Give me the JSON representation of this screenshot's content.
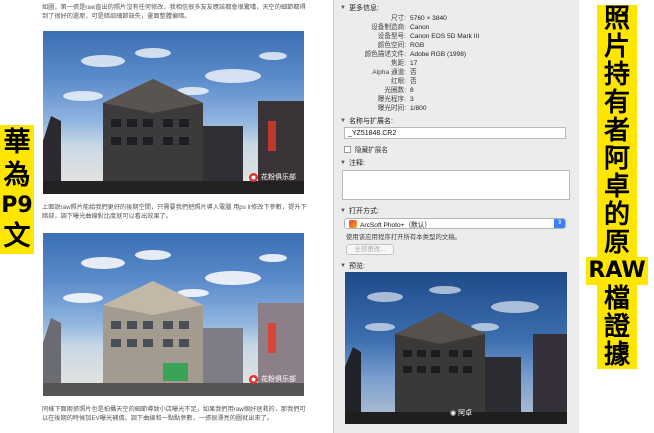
{
  "left_caption": [
    "華",
    "為",
    "P9",
    "文"
  ],
  "right_caption": [
    "照",
    "片",
    "持",
    "有",
    "者",
    "阿",
    "卓",
    "的",
    "原",
    "RAW",
    "檔",
    "證",
    "據"
  ],
  "article": {
    "para1": "如圖，第一張是raw直出的照片沒有任何修改，我相信很多友友應該都會很驚嘆，天空的細節都得到了很好的還原，可是暗部細節缺失，畫面整體偏暗。",
    "para2": "上面說raw照片能給我們更好的後期空間，只需要我們把照片導入電腦 用ps lr修改下參數，提升下暗部，調下曝光曲線對比度就可以看出效果了。",
    "para3": "同樣下面兩張照片也是拍攝天空的細節導致小店曝光不足，如果我們用raw個好拯救的，那我們可以在後期的時候加EV曝光補償。調下曲線和一點點參數，一張很漂亮的圖就出來了。",
    "watermark1": "花粉俱乐部",
    "watermark2": "花粉俱乐部"
  },
  "panel": {
    "more_info_header": "更多信息:",
    "info_rows": [
      {
        "k": "尺寸:",
        "v": "5760 × 3840"
      },
      {
        "k": "设备制造商:",
        "v": "Canon"
      },
      {
        "k": "设备型号:",
        "v": "Canon EOS 5D Mark III"
      },
      {
        "k": "颜色空间:",
        "v": "RGB"
      },
      {
        "k": "颜色描述文件:",
        "v": "Adobe RGB (1998)"
      },
      {
        "k": "焦距:",
        "v": "17"
      },
      {
        "k": "Alpha 通道:",
        "v": "否"
      },
      {
        "k": "红眼:",
        "v": "否"
      },
      {
        "k": "光圈数:",
        "v": "8"
      },
      {
        "k": "曝光程序:",
        "v": "3"
      },
      {
        "k": "曝光时间:",
        "v": "1/800"
      }
    ],
    "name_header": "名称与扩展名:",
    "filename": "_YZ51848.CR2",
    "hide_ext_label": "隐藏扩展名",
    "comments_header": "注释:",
    "open_with_header": "打开方式:",
    "open_with_app": "ArcSoft Photo+（默认）",
    "open_with_hint": "使用该应用程序打开所有本类型的文稿。",
    "change_all_button": "全部更改...",
    "preview_header": "预览:",
    "preview_watermark": "阿卓"
  },
  "colors": {
    "caption_bg": "#ffe600",
    "panel_bg": "#ececec",
    "select_accent": "#3b82f6"
  }
}
